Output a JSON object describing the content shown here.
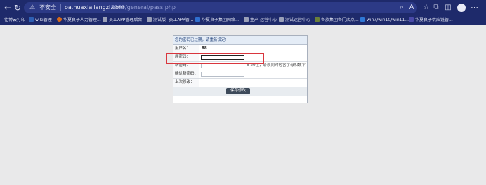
{
  "browser": {
    "insecure_label": "不安全",
    "url_host": "oa.huaxialiangzi.com",
    "url_path": ":8099/general/pass.php"
  },
  "bookmarks": [
    {
      "label": "佳博云打印",
      "color": ""
    },
    {
      "label": "wiki管理",
      "color": "#2e5fb3"
    },
    {
      "label": "华夏良子人力管理...",
      "color": "#d66a1a"
    },
    {
      "label": "员工APP管理后台",
      "color": "#444"
    },
    {
      "label": "测试版--员工APP管...",
      "color": "#444"
    },
    {
      "label": "华夏良子集团网络...",
      "color": "#2f6fcf"
    },
    {
      "label": "生产-运营中心",
      "color": "#444"
    },
    {
      "label": "测试运营中心",
      "color": "#444"
    },
    {
      "label": "各族集团各门店点...",
      "color": "#6a7f3a"
    },
    {
      "label": "win7/win10/win11...",
      "color": "#2f78d6"
    },
    {
      "label": "华夏良子供应链管...",
      "color": "#4a4aa8"
    }
  ],
  "form": {
    "notice": "您的密码已过期，请重新设定!",
    "username_label": "用户名：",
    "username_value": "88",
    "old_password_label": "原密码：",
    "new_password_label": "新密码：",
    "new_password_hint": "8-20位，必须同时包含字母和数字",
    "confirm_password_label": "确认新密码：",
    "last_modified_label": "上次修改：",
    "save_label": "保存修改"
  }
}
